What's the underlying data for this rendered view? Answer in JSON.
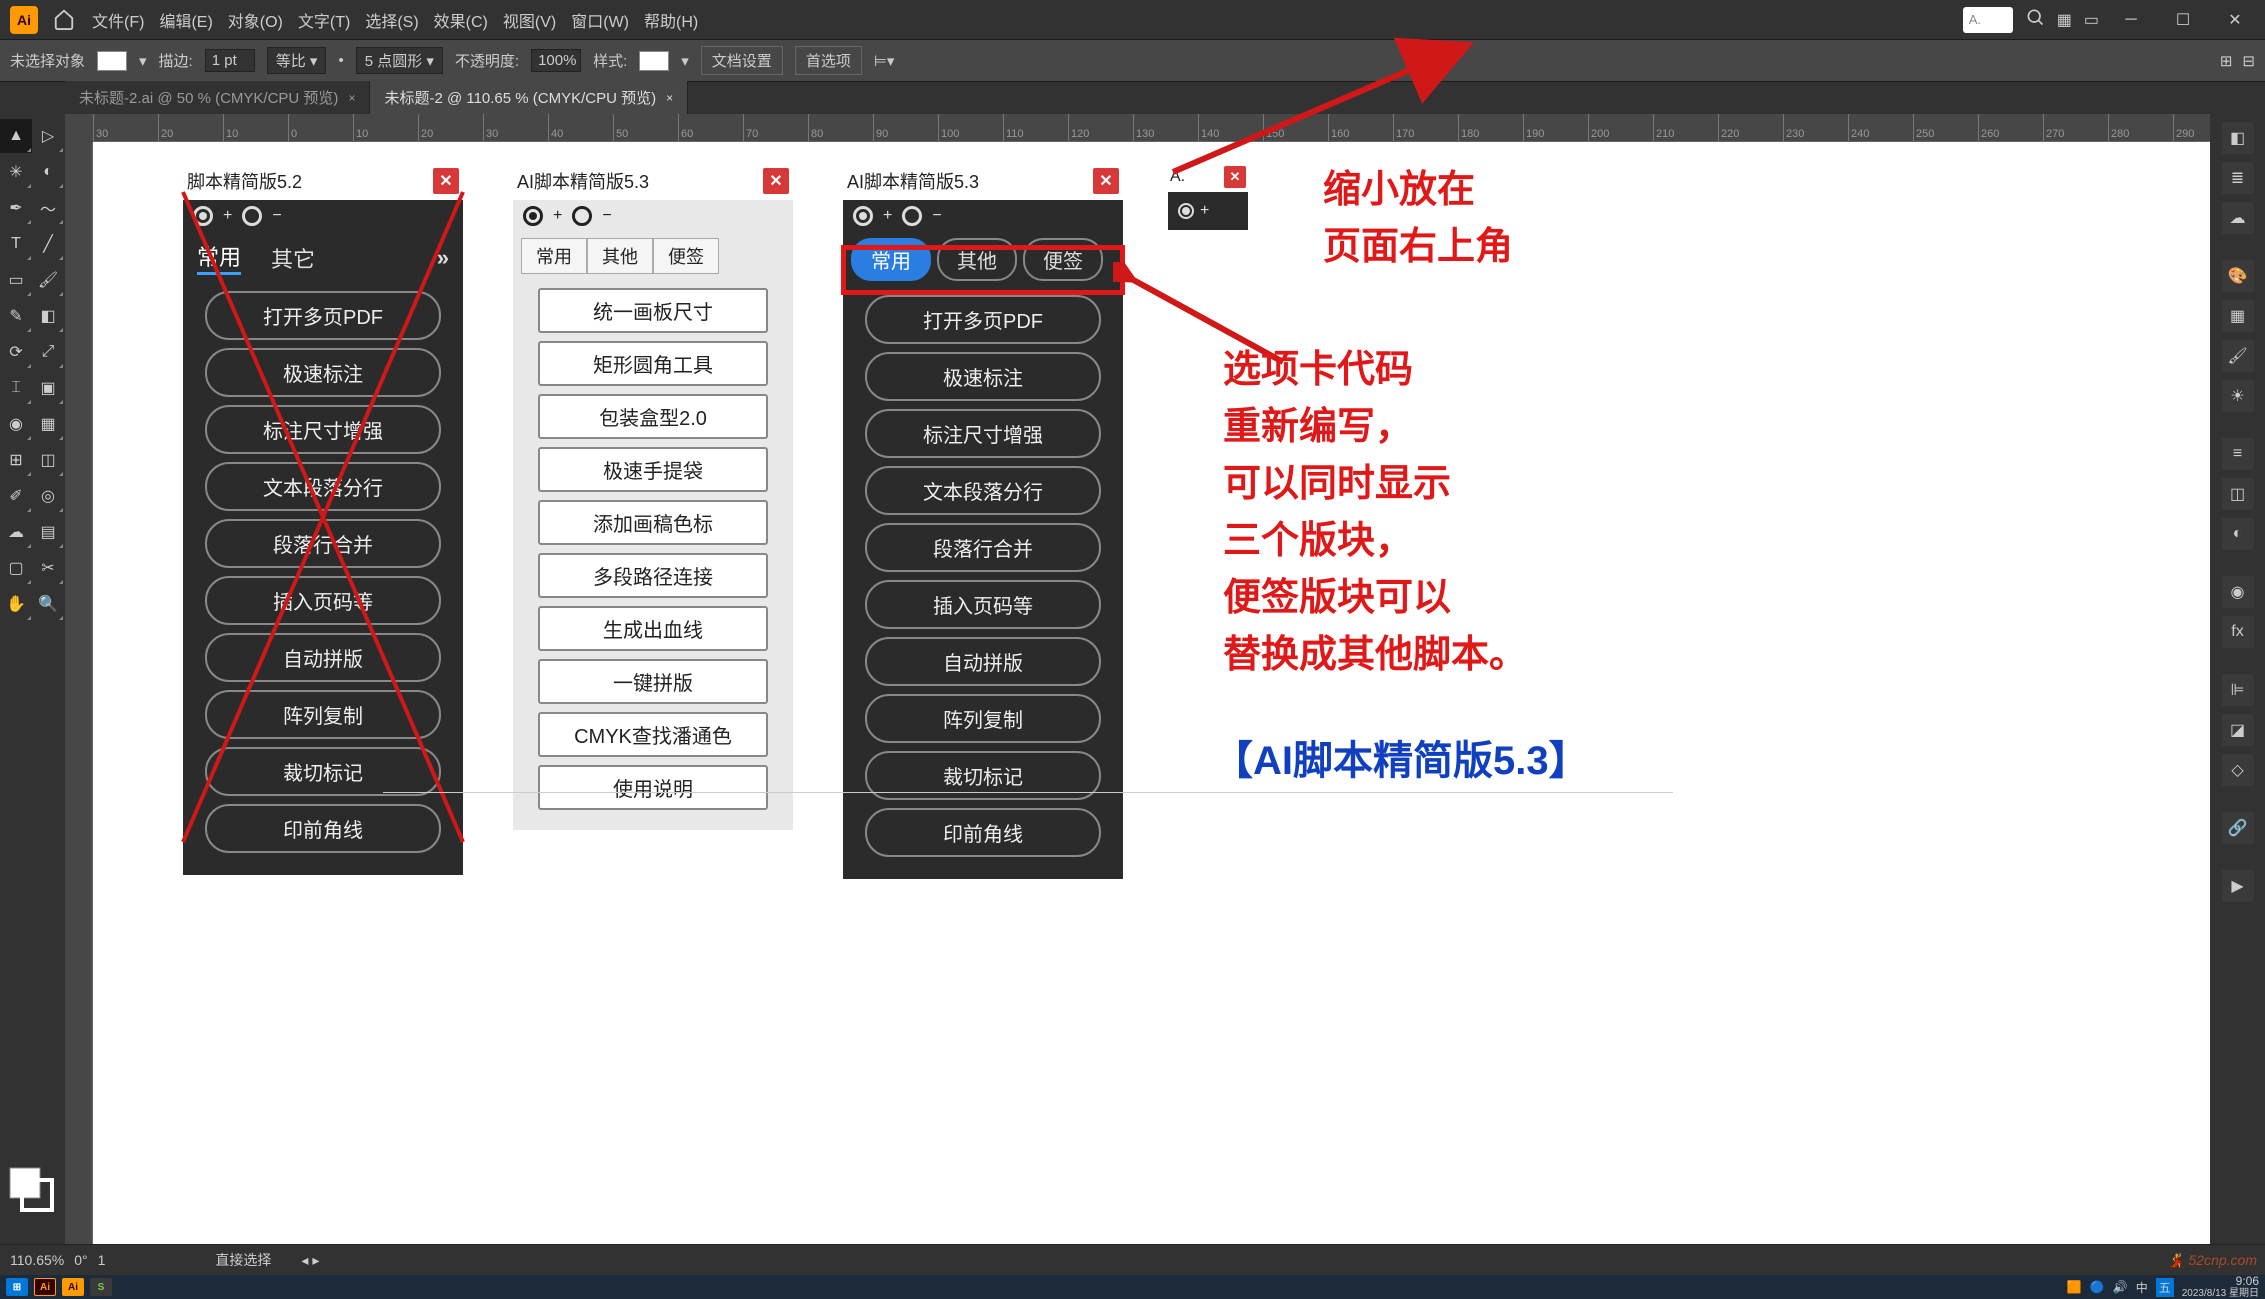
{
  "menubar": {
    "items": [
      "文件(F)",
      "编辑(E)",
      "对象(O)",
      "文字(T)",
      "选择(S)",
      "效果(C)",
      "视图(V)",
      "窗口(W)",
      "帮助(H)"
    ],
    "search_placeholder": "A."
  },
  "optbar": {
    "noselect": "未选择对象",
    "stroke_label": "描边:",
    "stroke_val": "1 pt",
    "uniform": "等比",
    "pt5": "5 点圆形",
    "opacity_label": "不透明度:",
    "opacity_val": "100%",
    "style_label": "样式:",
    "docset": "文档设置",
    "prefs": "首选项"
  },
  "tabs": [
    {
      "label": "未标题-2.ai @ 50 % (CMYK/CPU 预览)",
      "active": false
    },
    {
      "label": "未标题-2 @ 110.65 % (CMYK/CPU 预览)",
      "active": true
    }
  ],
  "ruler_marks": [
    "30",
    "20",
    "10",
    "0",
    "10",
    "20",
    "30",
    "40",
    "50",
    "60",
    "70",
    "80",
    "90",
    "100",
    "110",
    "120",
    "130",
    "140",
    "150",
    "160",
    "170",
    "180",
    "190",
    "200",
    "210",
    "220",
    "230",
    "240",
    "250",
    "260",
    "270",
    "280",
    "290"
  ],
  "panel52": {
    "title": "脚本精简版5.2",
    "tabs": [
      "常用",
      "其它"
    ],
    "buttons": [
      "打开多页PDF",
      "极速标注",
      "标注尺寸增强",
      "文本段落分行",
      "段落行合并",
      "插入页码等",
      "自动拼版",
      "阵列复制",
      "裁切标记",
      "印前角线"
    ]
  },
  "panel53light": {
    "title": "AI脚本精简版5.3",
    "tabs": [
      "常用",
      "其他",
      "便签"
    ],
    "buttons": [
      "统一画板尺寸",
      "矩形圆角工具",
      "包装盒型2.0",
      "极速手提袋",
      "添加画稿色标",
      "多段路径连接",
      "生成出血线",
      "一键拼版",
      "CMYK查找潘通色",
      "使用说明"
    ]
  },
  "panel53dark": {
    "title": "AI脚本精简版5.3",
    "tabs": [
      "常用",
      "其他",
      "便签"
    ],
    "buttons": [
      "打开多页PDF",
      "极速标注",
      "标注尺寸增强",
      "文本段落分行",
      "段落行合并",
      "插入页码等",
      "自动拼版",
      "阵列复制",
      "裁切标记",
      "印前角线"
    ]
  },
  "mini": {
    "title": "A."
  },
  "anno_top": "缩小放在\n页面右上角",
  "anno_mid": "选项卡代码\n重新编写，\n可以同时显示\n三个版块，\n便签版块可以\n替换成其他脚本。",
  "anno_bottom": "【AI脚本精简版5.3】",
  "status": {
    "zoom": "110.65%",
    "angle": "0°",
    "artboard": "1",
    "tool": "直接选择"
  },
  "taskbar": {
    "time": "9:06",
    "date": "2023/8/13 星期日"
  },
  "watermark": "52cnp.com"
}
